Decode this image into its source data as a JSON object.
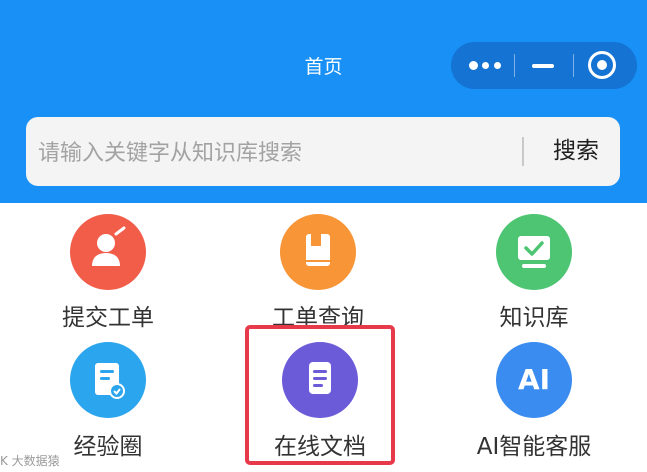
{
  "header": {
    "title": "首页"
  },
  "search": {
    "placeholder": "请输入关键字从知识库搜索",
    "button_label": "搜索"
  },
  "grid": {
    "items": [
      {
        "label": "提交工单",
        "icon": "person-icon",
        "color": "#f25d4a"
      },
      {
        "label": "工单查询",
        "icon": "book-icon",
        "color": "#f89536"
      },
      {
        "label": "知识库",
        "icon": "monitor-check-icon",
        "color": "#4ec573"
      },
      {
        "label": "经验圈",
        "icon": "document-check-icon",
        "color": "#2ba6ee"
      },
      {
        "label": "在线文档",
        "icon": "document-icon",
        "color": "#6c5bd8"
      },
      {
        "label": "AI智能客服",
        "icon": "ai-icon",
        "color": "#3a8cf0",
        "icon_text": "AI"
      }
    ]
  },
  "highlighted_item": "在线文档",
  "watermark": "K 大数据猿"
}
